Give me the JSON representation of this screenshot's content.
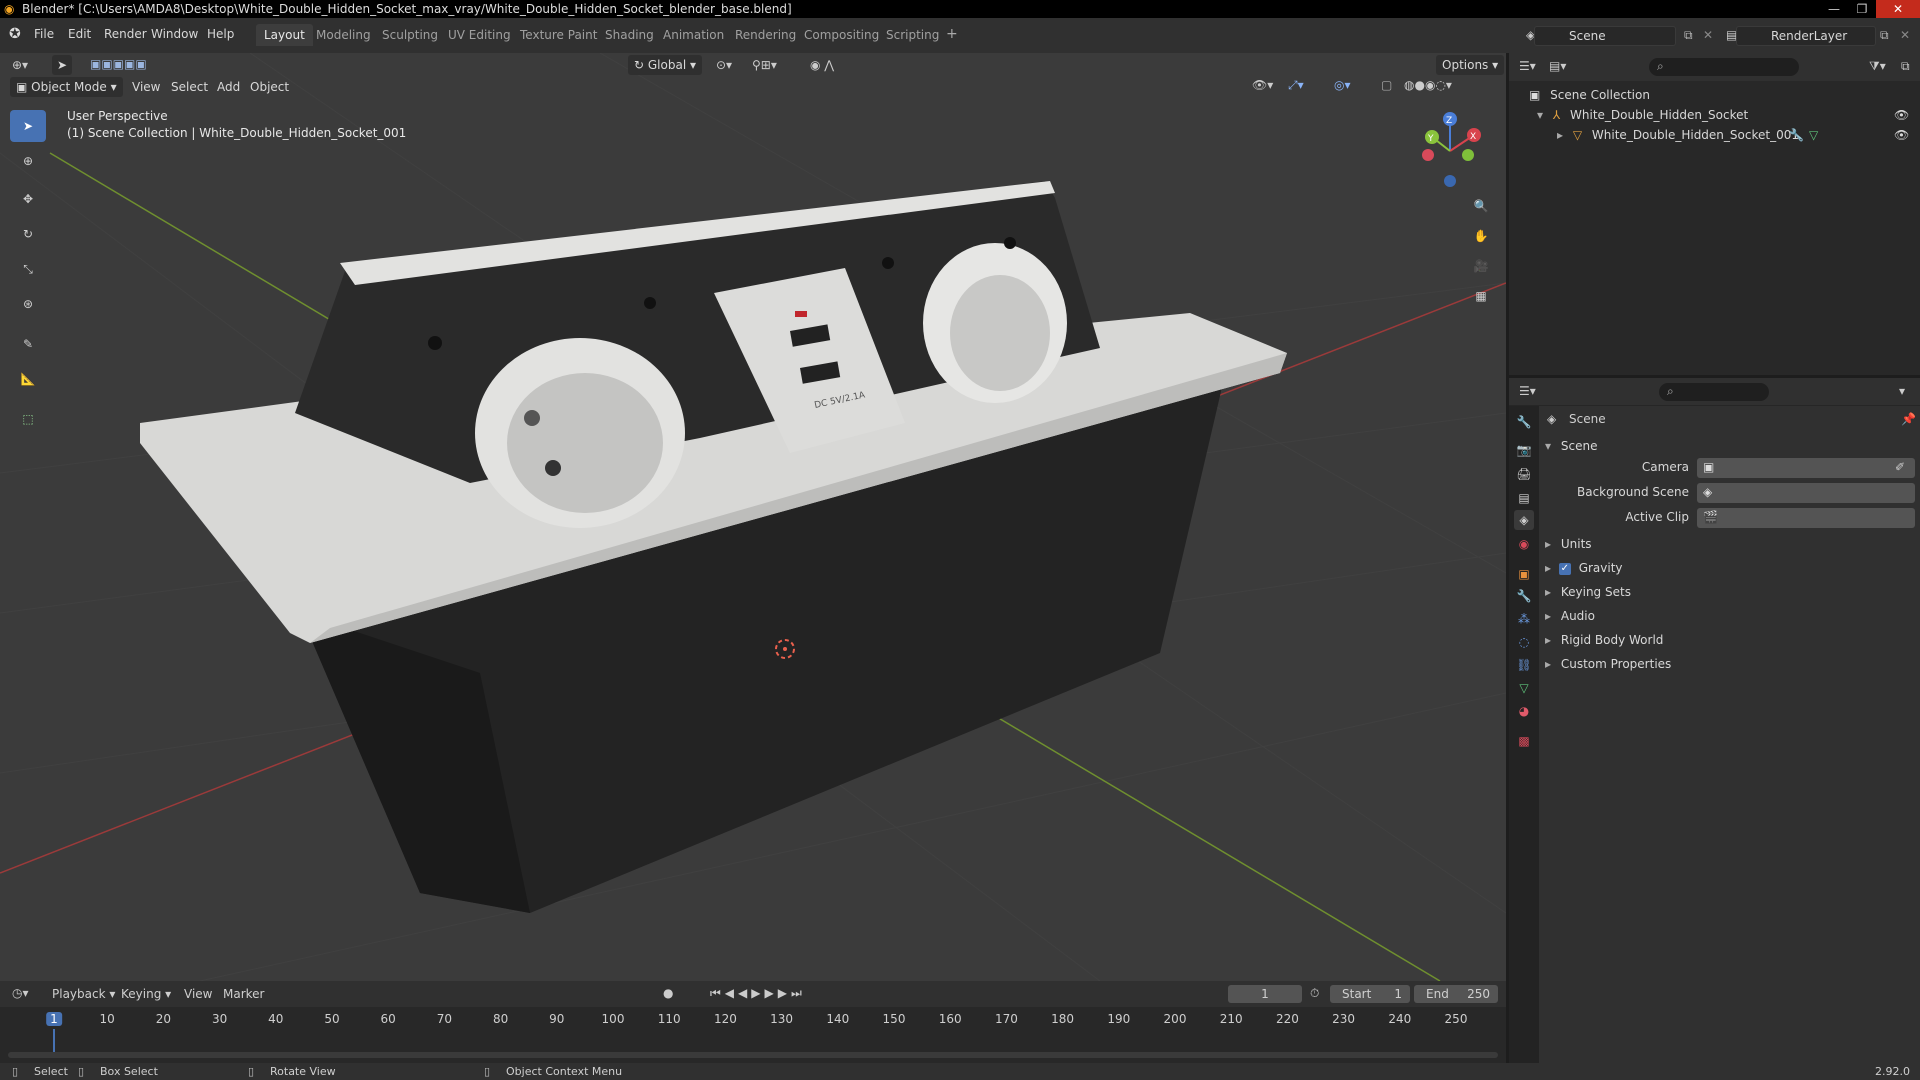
{
  "window": {
    "title": "Blender* [C:\\Users\\AMDA8\\Desktop\\White_Double_Hidden_Socket_max_vray/White_Double_Hidden_Socket_blender_base.blend]"
  },
  "menu": [
    "File",
    "Edit",
    "Render",
    "Window",
    "Help"
  ],
  "workspaces": [
    "Layout",
    "Modeling",
    "Sculpting",
    "UV Editing",
    "Texture Paint",
    "Shading",
    "Animation",
    "Rendering",
    "Compositing",
    "Scripting"
  ],
  "active_workspace": "Layout",
  "scene_field": "Scene",
  "view_layer_field": "RenderLayer",
  "viewport": {
    "mode": "Object Mode",
    "menus": [
      "View",
      "Select",
      "Add",
      "Object"
    ],
    "transform_orientation": "Global",
    "options_label": "Options",
    "overlay_line1": "User Perspective",
    "overlay_line2": "(1) Scene Collection | White_Double_Hidden_Socket_001",
    "gizmo_axes": [
      "X",
      "Y",
      "Z"
    ],
    "product_text": "DC 5V/2.1A",
    "colors": {
      "background": "#3b3b3b",
      "grid_x": "#9b3a3a",
      "grid_y": "#6f8f2f",
      "active_tool": "#4772b3"
    }
  },
  "outliner": {
    "root": "Scene Collection",
    "items": [
      {
        "label": "White_Double_Hidden_Socket",
        "icon": "armature-icon"
      },
      {
        "label": "White_Double_Hidden_Socket_001",
        "icon": "mesh-icon"
      }
    ]
  },
  "properties": {
    "context_title": "Scene",
    "panel_title": "Scene",
    "fields": [
      {
        "label": "Camera"
      },
      {
        "label": "Background Scene"
      },
      {
        "label": "Active Clip"
      }
    ],
    "panels": [
      {
        "label": "Units",
        "checkbox": false
      },
      {
        "label": "Gravity",
        "checkbox": true,
        "checked": true
      },
      {
        "label": "Keying Sets",
        "checkbox": false
      },
      {
        "label": "Audio",
        "checkbox": false
      },
      {
        "label": "Rigid Body World",
        "checkbox": false
      },
      {
        "label": "Custom Properties",
        "checkbox": false
      }
    ]
  },
  "timeline": {
    "menus": [
      "Playback",
      "Keying",
      "View",
      "Marker"
    ],
    "current_frame": "1",
    "start_label": "Start",
    "start_value": "1",
    "end_label": "End",
    "end_value": "250",
    "ruler": [
      "1",
      "10",
      "20",
      "30",
      "40",
      "50",
      "60",
      "70",
      "80",
      "90",
      "100",
      "110",
      "120",
      "130",
      "140",
      "150",
      "160",
      "170",
      "180",
      "190",
      "200",
      "210",
      "220",
      "230",
      "240",
      "250"
    ]
  },
  "statusbar": {
    "select": "Select",
    "box_select": "Box Select",
    "rotate_view": "Rotate View",
    "context_menu": "Object Context Menu",
    "version": "2.92.0"
  }
}
